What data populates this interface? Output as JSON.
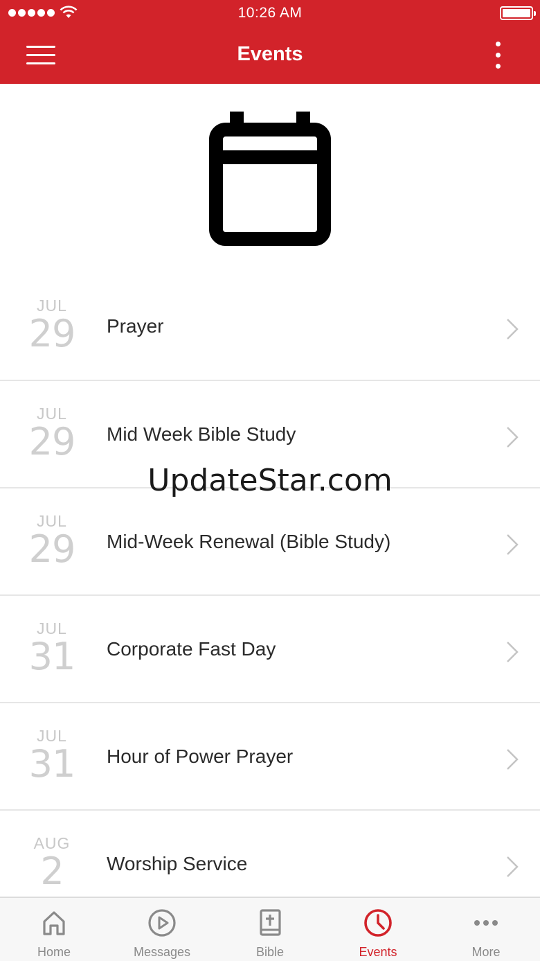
{
  "status_bar": {
    "time": "10:26 AM"
  },
  "header": {
    "title": "Events",
    "menu_icon": "hamburger-menu-icon",
    "overflow_icon": "vertical-ellipsis-icon",
    "color": "#d2232a"
  },
  "hero": {
    "icon": "calendar-icon"
  },
  "events": [
    {
      "month": "JUL",
      "day": "29",
      "title": "Prayer"
    },
    {
      "month": "JUL",
      "day": "29",
      "title": "Mid Week Bible Study"
    },
    {
      "month": "JUL",
      "day": "29",
      "title": "Mid-Week Renewal (Bible Study)"
    },
    {
      "month": "JUL",
      "day": "31",
      "title": "Corporate Fast Day"
    },
    {
      "month": "JUL",
      "day": "31",
      "title": "Hour of Power Prayer"
    },
    {
      "month": "AUG",
      "day": "2",
      "title": "Worship Service"
    }
  ],
  "watermark": "UpdateStar.com",
  "tabs": [
    {
      "label": "Home",
      "icon": "home-icon",
      "active": false
    },
    {
      "label": "Messages",
      "icon": "play-circle-icon",
      "active": false
    },
    {
      "label": "Bible",
      "icon": "bible-icon",
      "active": false
    },
    {
      "label": "Events",
      "icon": "clock-icon",
      "active": true
    },
    {
      "label": "More",
      "icon": "more-dots-icon",
      "active": false
    }
  ],
  "colors": {
    "accent": "#d2232a",
    "inactive_tab": "#8a8a8a",
    "date_text": "#c8c8c8"
  }
}
